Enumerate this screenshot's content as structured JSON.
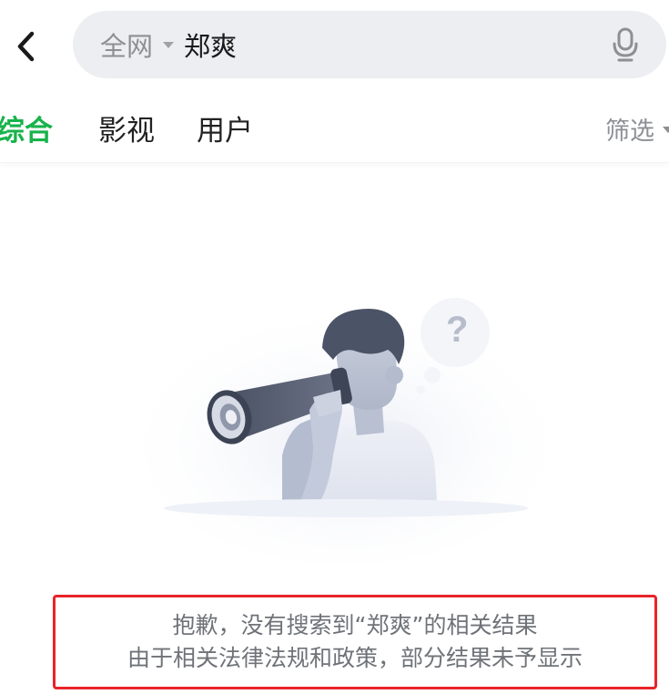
{
  "header": {
    "back_icon": "chevron-left-icon",
    "search": {
      "scope_label": "全网",
      "scope_icon": "caret-down-icon",
      "query": "郑爽",
      "mic_icon": "microphone-icon"
    }
  },
  "tabs": [
    {
      "label": "综合",
      "active": true
    },
    {
      "label": "影视",
      "active": false
    },
    {
      "label": "用户",
      "active": false
    }
  ],
  "filter": {
    "label": "筛选",
    "icon": "caret-down-icon"
  },
  "empty_state": {
    "illustration": "telescope-person-illustration",
    "question_mark": "?",
    "line1": "抱歉，没有搜索到“郑爽”的相关结果",
    "line2": "由于相关法律法规和政策，部分结果未予显示"
  },
  "colors": {
    "accent_green": "#18b34b",
    "highlight_red": "#e8242a",
    "search_bg": "#eceef1",
    "muted_text": "#8c8f94"
  }
}
